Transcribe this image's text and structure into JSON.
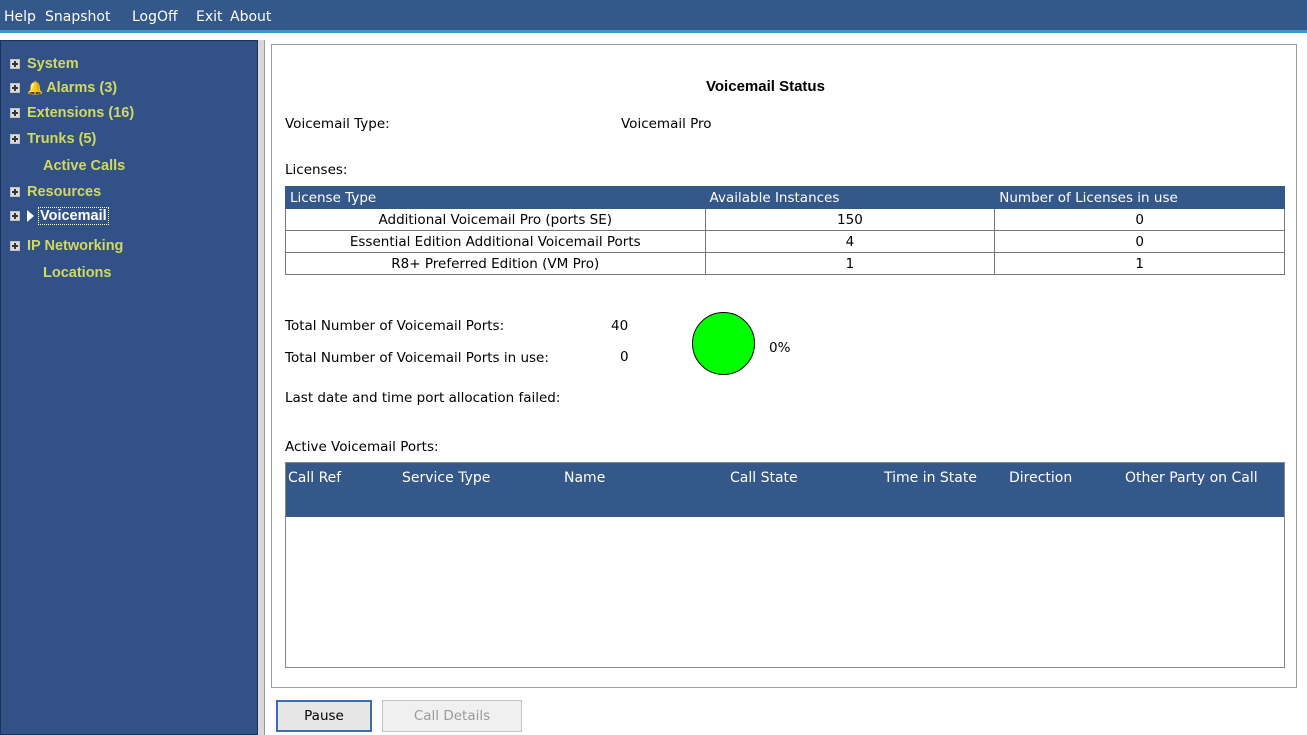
{
  "menu": [
    "Help",
    "Snapshot",
    "LogOff",
    "Exit",
    "About"
  ],
  "tree": [
    {
      "label": "System",
      "expandable": true
    },
    {
      "label": "Alarms (3)",
      "expandable": true,
      "icon": "alarm-bell-icon"
    },
    {
      "label": "Extensions (16)",
      "expandable": true
    },
    {
      "label": "Trunks (5)",
      "expandable": true
    },
    {
      "label": "Active Calls",
      "expandable": false
    },
    {
      "label": "Resources",
      "expandable": true
    },
    {
      "label": "Voicemail",
      "expandable": true,
      "selected": true,
      "icon": "arrow-right-icon"
    },
    {
      "label": "IP Networking",
      "expandable": true
    },
    {
      "label": "Locations",
      "expandable": false
    }
  ],
  "page": {
    "title": "Voicemail Status",
    "voicemail_type_label": "Voicemail Type:",
    "voicemail_type_value": "Voicemail Pro",
    "licenses_label": "Licenses:",
    "total_ports_label": "Total Number of Voicemail Ports:",
    "total_ports_value": "40",
    "ports_in_use_label": "Total Number of Voicemail Ports in use:",
    "ports_in_use_value": "0",
    "usage_percent": "0%",
    "last_failed_label": "Last date and time port allocation failed:",
    "active_ports_label": "Active Voicemail Ports:"
  },
  "licenses": {
    "headers": [
      "License Type",
      "Available Instances",
      "Number of Licenses in use"
    ],
    "rows": [
      [
        "Additional Voicemail Pro (ports SE)",
        "150",
        "0"
      ],
      [
        "Essential Edition Additional Voicemail Ports",
        "4",
        "0"
      ],
      [
        "R8+ Preferred Edition (VM Pro)",
        "1",
        "1"
      ]
    ]
  },
  "ports_table": {
    "headers": [
      "Call Ref",
      "Service Type",
      "Name",
      "Call State",
      "Time in State",
      "Direction",
      "Other Party on Call"
    ]
  },
  "buttons": {
    "pause": "Pause",
    "call_details": "Call Details"
  },
  "colors": {
    "header_blue": "#34588a",
    "tree_text": "#d2d860",
    "usage_green": "#00ff00"
  }
}
